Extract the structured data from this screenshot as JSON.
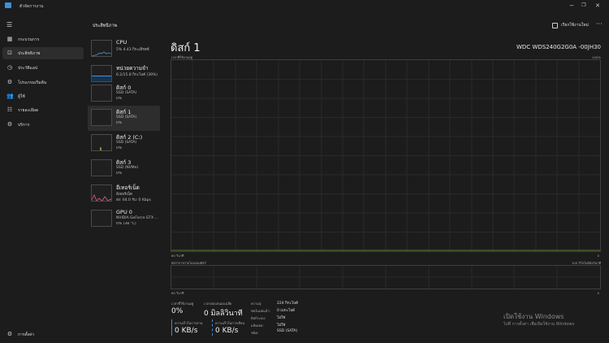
{
  "window": {
    "title": "ตัวจัดการงาน"
  },
  "nav": {
    "items": [
      {
        "label": "กระบวนการ",
        "icon": "grid-icon"
      },
      {
        "label": "ประสิทธิภาพ",
        "icon": "performance-icon",
        "active": true
      },
      {
        "label": "ประวัติแอป",
        "icon": "history-icon"
      },
      {
        "label": "โปรแกรมเริ่มต้น",
        "icon": "startup-icon"
      },
      {
        "label": "ผู้ใช้",
        "icon": "users-icon"
      },
      {
        "label": "รายละเอียด",
        "icon": "details-icon"
      },
      {
        "label": "บริการ",
        "icon": "services-icon"
      }
    ],
    "settings_label": "การตั้งค่า"
  },
  "header": {
    "section_title": "ประสิทธิภาพ",
    "run_task_label": "เรียกใช้งานใหม่"
  },
  "devices": [
    {
      "name": "CPU",
      "sub": "5% 4.43 กิกะเฮิรตซ์",
      "val": "",
      "accent": "#4a90d9"
    },
    {
      "name": "หน่วยความจำ",
      "sub": "6.2/15.8 กิกะไบต์ (39%)",
      "val": "",
      "accent": "#4a90d9"
    },
    {
      "name": "ดิสก์ 0",
      "sub": "SSD (SATA)",
      "val": "0%",
      "accent": "#8bbf3c"
    },
    {
      "name": "ดิสก์ 1",
      "sub": "SSD (SATA)",
      "val": "0%",
      "accent": "#8bbf3c",
      "active": true
    },
    {
      "name": "ดิสก์ 2 (C:)",
      "sub": "SSD (SATA)",
      "val": "0%",
      "accent": "#8bbf3c"
    },
    {
      "name": "ดิสก์ 3",
      "sub": "SSD (NVMe)",
      "val": "0%",
      "accent": "#8bbf3c"
    },
    {
      "name": "อีเทอร์เน็ต",
      "sub": "อีเทอร์เน็ต",
      "val": "ส่ง: 64.0 รับ: 0 Kbps",
      "accent": "#d9608a"
    },
    {
      "name": "GPU 0",
      "sub": "NVIDIA GeForce GTX ...",
      "val": "0% (38 °C)",
      "accent": "#4a90d9"
    }
  ],
  "detail": {
    "title": "ดิสก์ 1",
    "model": "WDC WDS240G2G0A -00JH30",
    "chart1_label": "เวลาที่ใช้งานอยู่",
    "chart1_max": "100%",
    "chart1_left": "60 วินาที",
    "chart1_right": "0",
    "chart2_label": "อัตราการถ่ายโอนของดิสก์",
    "chart2_max": "100 กิโลไบต์ต่อวินาที",
    "chart2_left": "60 วินาที",
    "chart2_right": "0",
    "active_time_label": "เวลาที่ใช้งานอยู่",
    "active_time_value": "0%",
    "response_label": "เวลาตอบสนองเฉลี่ย",
    "response_value": "0 มิลลิวินาที",
    "read_label": "ความเร็วในการอ่าน",
    "read_value": "0 KB/s",
    "write_label": "ความเร็วในการเขียน",
    "write_value": "0 KB/s",
    "props": [
      {
        "key": "ความจุ:",
        "val": "224 กิกะไบต์"
      },
      {
        "key": "ฟอร์แมตแล้ว:",
        "val": "0 เมกะไบต์"
      },
      {
        "key": "ดิสก์ระบบ:",
        "val": "ไม่ใช่"
      },
      {
        "key": "แฟ้มเพจ:",
        "val": "ไม่ใช่"
      },
      {
        "key": "ชนิด:",
        "val": "SSD (SATA)"
      }
    ]
  },
  "watermark": {
    "line1": "เปิดใช้งาน Windows",
    "line2": "ไปที่ การตั้งค่า เพื่อเปิดใช้งาน Windows"
  }
}
